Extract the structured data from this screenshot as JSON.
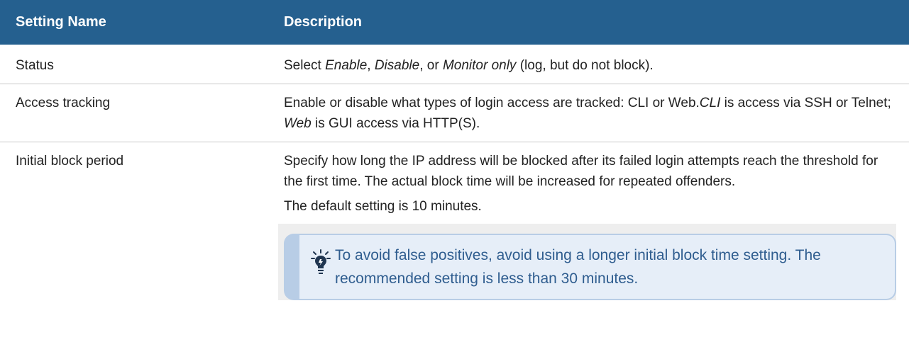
{
  "header": {
    "setting_name": "Setting Name",
    "description": "Description"
  },
  "rows": [
    {
      "name": "Status",
      "parts": [
        "Select ",
        "Enable",
        ", ",
        "Disable",
        ", or ",
        "Monitor only",
        " (log, but do not block)."
      ]
    },
    {
      "name": "Access tracking",
      "parts": [
        "Enable or disable what types of login access are tracked: CLI or Web.",
        "CLI",
        " is access via SSH or Telnet; ",
        "Web",
        " is GUI access via HTTP(S)."
      ]
    },
    {
      "name": "Initial block period",
      "para1": "Specify how long the IP address will be blocked after its failed login attempts reach the threshold for the first time. The actual block time will be increased for repeated offenders.",
      "para2": "The default setting is 10 minutes.",
      "tip": "To avoid false positives, avoid using a longer initial block time setting. The recommended setting is less than 30 minutes.",
      "tip_icon": "lightbulb-icon"
    }
  ],
  "colors": {
    "header_bg": "#25608f",
    "tip_bg": "#e6eef8",
    "tip_border": "#b8cde6",
    "tip_text": "#2f5d8f"
  }
}
